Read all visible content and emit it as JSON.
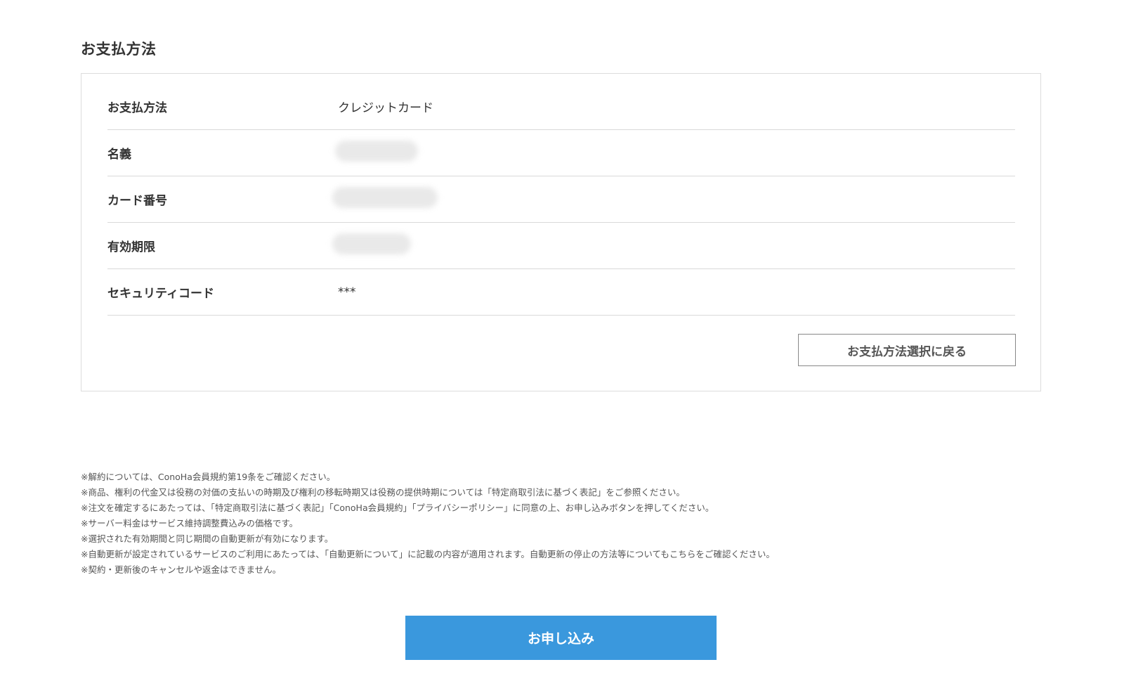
{
  "section": {
    "title": "お支払方法"
  },
  "payment": {
    "rows": [
      {
        "label": "お支払方法",
        "value": "クレジットカード"
      },
      {
        "label": "名義",
        "value": ""
      },
      {
        "label": "カード番号",
        "value": ""
      },
      {
        "label": "有効期限",
        "value": ""
      },
      {
        "label": "セキュリティコード",
        "value": "***"
      }
    ],
    "back_label": "お支払方法選択に戻る"
  },
  "notes": [
    "※解約については、ConoHa会員規約第19条をご確認ください。",
    "※商品、権利の代金又は役務の対価の支払いの時期及び権利の移転時期又は役務の提供時期については「特定商取引法に基づく表記」をご参照ください。",
    "※注文を確定するにあたっては、「特定商取引法に基づく表記」「ConoHa会員規約」「プライバシーポリシー」に同意の上、お申し込みボタンを押してください。",
    "※サーバー料金はサービス維持調整費込みの価格です。",
    "※選択された有効期間と同じ期間の自動更新が有効になります。",
    "※自動更新が設定されているサービスのご利用にあたっては、「自動更新について」に記載の内容が適用されます。自動更新の停止の方法等についてもこちらをご確認ください。",
    "※契約・更新後のキャンセルや返金はできません。"
  ],
  "apply": {
    "label": "お申し込み",
    "color": "#3a98dd"
  }
}
